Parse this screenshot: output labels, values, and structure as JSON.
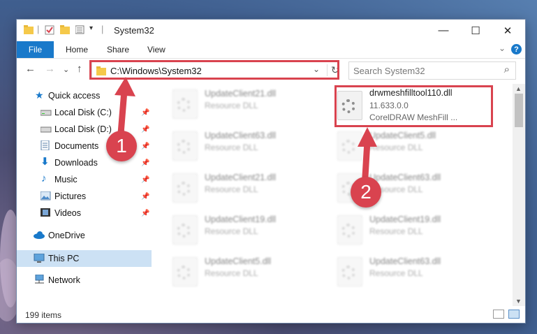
{
  "window": {
    "title": "System32",
    "minimize_glyph": "—",
    "maximize_glyph": "☐",
    "close_glyph": "✕"
  },
  "ribbon": {
    "tabs": [
      "File",
      "Home",
      "Share",
      "View"
    ],
    "help_glyph": "?",
    "collapse_glyph": "⌄"
  },
  "nav": {
    "back_glyph": "←",
    "forward_glyph": "→",
    "recent_glyph": "⌄",
    "up_glyph": "↑",
    "address": "C:\\Windows\\System32",
    "dropdown_glyph": "⌄",
    "refresh_glyph": "↻",
    "search_placeholder": "Search System32",
    "search_glyph": "⌕"
  },
  "sidebar": {
    "quick_access": "Quick access",
    "items": [
      {
        "label": "Local Disk (C:)",
        "icon": "drive-icon"
      },
      {
        "label": "Local Disk (D:)",
        "icon": "drive-icon"
      },
      {
        "label": "Documents",
        "icon": "documents-icon"
      },
      {
        "label": "Downloads",
        "icon": "downloads-icon"
      },
      {
        "label": "Music",
        "icon": "music-icon"
      },
      {
        "label": "Pictures",
        "icon": "pictures-icon"
      },
      {
        "label": "Videos",
        "icon": "videos-icon"
      }
    ],
    "onedrive": "OneDrive",
    "this_pc": "This PC",
    "network": "Network"
  },
  "files": {
    "left": [
      {
        "name": "UpdateClient21.dll",
        "type": "Resource DLL"
      },
      {
        "name": "UpdateClient63.dll",
        "type": "Resource DLL"
      },
      {
        "name": "UpdateClient21.dll",
        "type": "Resource DLL"
      },
      {
        "name": "UpdateClient19.dll",
        "type": "Resource DLL"
      },
      {
        "name": "UpdateClient5.dll",
        "type": "Resource DLL"
      }
    ],
    "right": [
      {
        "name": "UpdateClient5.dll",
        "type": "Resource DLL"
      },
      {
        "name": "UpdateClient63.dll",
        "type": "Resource DLL"
      },
      {
        "name": "UpdateClient19.dll",
        "type": "Resource DLL"
      },
      {
        "name": "UpdateClient63.dll",
        "type": "Resource DLL"
      }
    ],
    "highlighted": {
      "name": "drwmeshfilltool110.dll",
      "version": "11.633.0.0",
      "description": "CorelDRAW MeshFill ..."
    }
  },
  "status": {
    "count": "199 items"
  },
  "annotations": {
    "marker1": "1",
    "marker2": "2",
    "color": "#d9434f"
  }
}
